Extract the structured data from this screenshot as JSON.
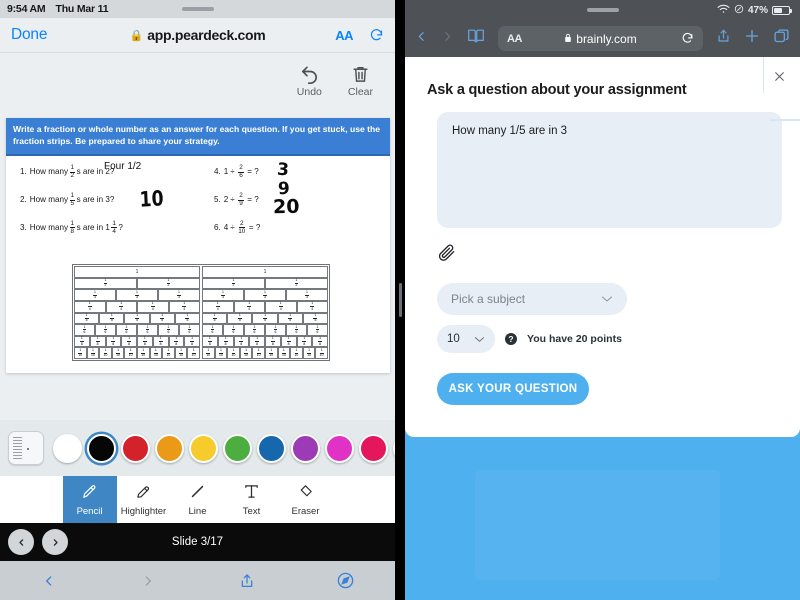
{
  "left": {
    "status": {
      "time": "9:54 AM",
      "date": "Thu Mar 11"
    },
    "browser": {
      "done_label": "Done",
      "url": "app.peardeck.com",
      "lock_icon": "lock-icon",
      "text_size_label": "AA",
      "reload_icon": "reload-icon"
    },
    "toolbar": {
      "undo_label": "Undo",
      "clear_label": "Clear"
    },
    "slide": {
      "banner": "Write a fraction or whole number as an answer for each question. If you get stuck, use the fraction strips. Be prepared to share your strategy.",
      "questions_left": [
        {
          "num": "1.",
          "pre": "How many",
          "frac_num": "1",
          "frac_den": "2",
          "post": "s are in 2?"
        },
        {
          "num": "2.",
          "pre": "How many",
          "frac_num": "1",
          "frac_den": "5",
          "post": "s are in 3?"
        },
        {
          "num": "3.",
          "pre": "How many",
          "frac_num": "1",
          "frac_den": "8",
          "post": "s are in 1",
          "mixed_num": "1",
          "mixed_den": "4",
          "post2": "?"
        }
      ],
      "questions_right": [
        {
          "num": "4.",
          "whole": "1",
          "op": "÷",
          "frac_num": "2",
          "frac_den": "6",
          "eq": "= ?"
        },
        {
          "num": "5.",
          "whole": "2",
          "op": "÷",
          "frac_num": "2",
          "frac_den": "9",
          "eq": "= ?"
        },
        {
          "num": "6.",
          "whole": "4",
          "op": "÷",
          "frac_num": "2",
          "frac_den": "10",
          "eq": "= ?"
        }
      ],
      "typed_answer_q1": "Four 1/2",
      "handwritten": {
        "q3": "10",
        "q4": "3",
        "q5": "9",
        "q6": "20"
      },
      "strips": {
        "whole_label": "1",
        "rows": [
          1,
          2,
          3,
          4,
          5,
          6,
          8,
          10
        ],
        "blocks": 2
      }
    },
    "palette": {
      "ruler_icon": "ruler-icon",
      "selected_index": 1,
      "colors": [
        "#ffffff",
        "#060606",
        "#d32229",
        "#eb9a18",
        "#f5cc2c",
        "#4cae3f",
        "#1667ac",
        "#9c3bb5",
        "#e033c6",
        "#e5175c",
        "#ef9a1a"
      ]
    },
    "tools": [
      {
        "label": "Pencil",
        "icon": "pencil-icon",
        "active": true
      },
      {
        "label": "Highlighter",
        "icon": "highlighter-icon",
        "active": false
      },
      {
        "label": "Line",
        "icon": "line-icon",
        "active": false
      },
      {
        "label": "Text",
        "icon": "text-icon",
        "active": false
      },
      {
        "label": "Eraser",
        "icon": "eraser-icon",
        "active": false
      }
    ],
    "slide_nav": {
      "prev_icon": "chevron-left-icon",
      "next_icon": "chevron-right-icon",
      "counter": "Slide 3/17"
    },
    "safari_nav": {
      "back_icon": "chevron-left-icon",
      "forward_icon": "chevron-right-icon",
      "share_icon": "share-icon",
      "compass_icon": "compass-icon"
    }
  },
  "right": {
    "status": {
      "wifi_icon": "wifi-icon",
      "location_icon": "location-icon",
      "battery_percent": "47%"
    },
    "toolbar": {
      "back_icon": "chevron-left-icon",
      "forward_icon": "chevron-right-icon",
      "bookmarks_icon": "book-icon",
      "text_size_label": "AA",
      "lock_icon": "lock-icon",
      "url": "brainly.com",
      "reload_icon": "reload-icon",
      "share_icon": "share-icon",
      "newtab_icon": "plus-icon",
      "tabs_icon": "tabs-icon"
    },
    "sheet": {
      "title": "Ask a question about your assignment",
      "close_icon": "close-icon",
      "question_value": "How many 1/5 are in 3",
      "attach_icon": "paperclip-icon",
      "subject_placeholder": "Pick a subject",
      "subject_chevron": "chevron-down-icon",
      "points_value": "10",
      "points_chevron": "chevron-down-icon",
      "help_icon": "question-mark-icon",
      "points_message": "You have 20 points",
      "ask_button": "ASK YOUR QUESTION"
    },
    "page_background_color": "#4fb0ef"
  }
}
